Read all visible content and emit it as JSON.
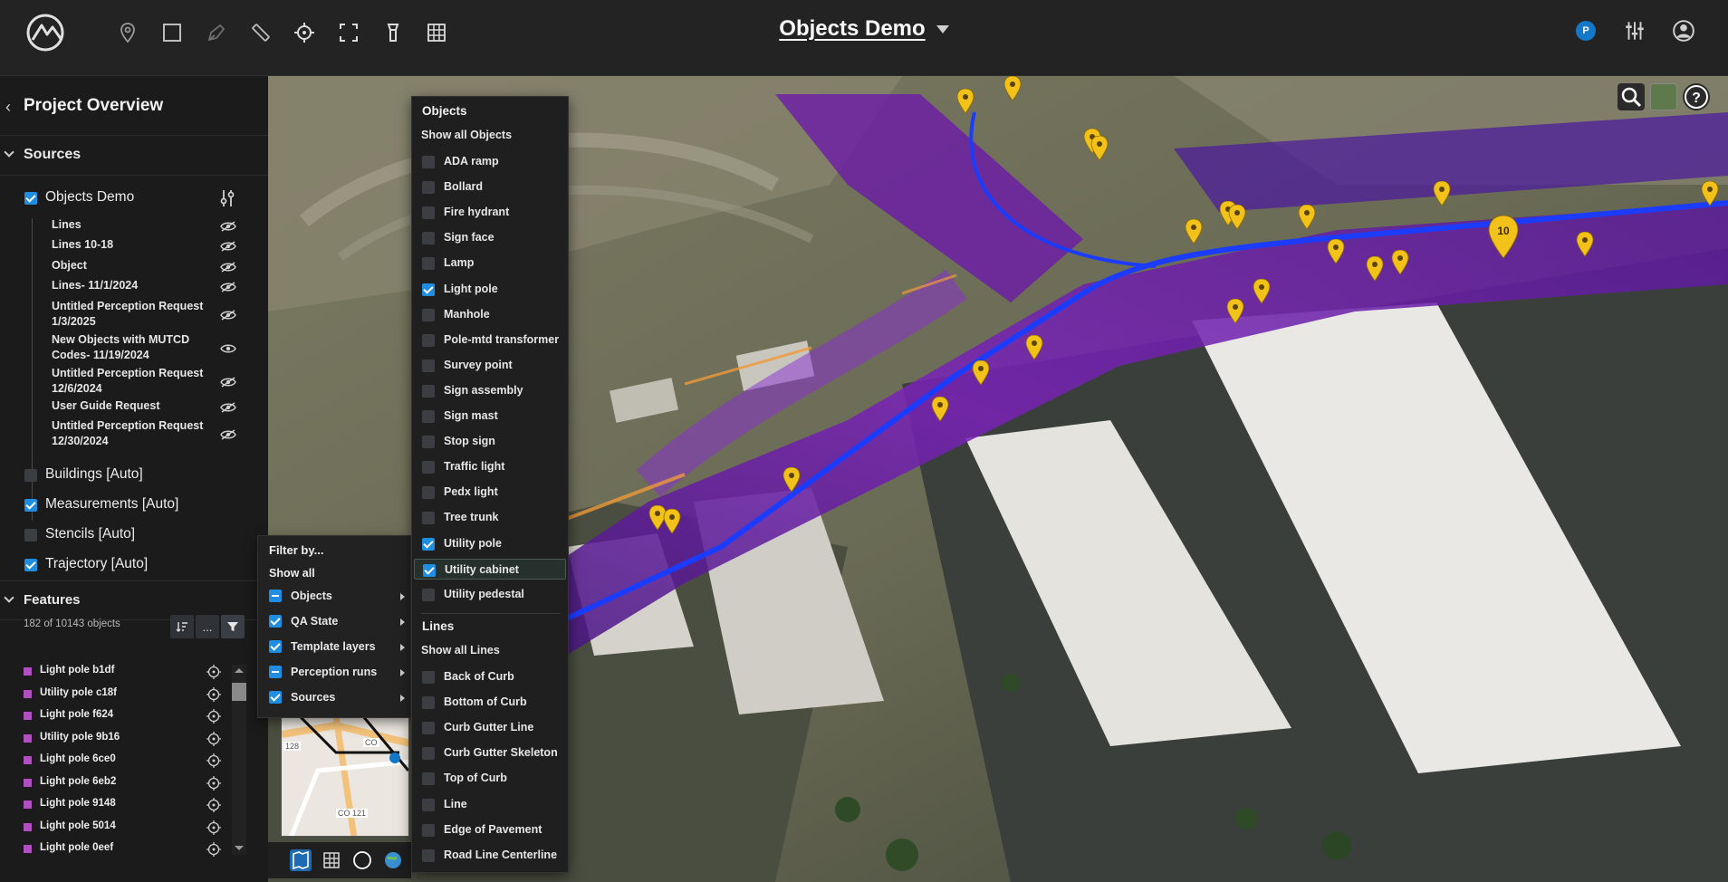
{
  "app": {
    "project_title": "Objects Demo",
    "user_initial": "P",
    "toolbar_icons": [
      "location-pin-icon",
      "rectangle-select-icon",
      "draw-polygon-icon",
      "ruler-icon",
      "crosshair-icon",
      "fullscreen-icon",
      "flashlight-icon",
      "grid-layers-icon"
    ],
    "accent_color": "#1f8de0",
    "marker_color": "#f2c21b"
  },
  "sidebar": {
    "overview_title": "Project Overview",
    "sources_heading": "Sources",
    "sources": [
      {
        "label": "Objects Demo",
        "checked": true
      },
      {
        "label": "Buildings [Auto]",
        "checked": false
      },
      {
        "label": "Measurements [Auto]",
        "checked": true
      },
      {
        "label": "Stencils [Auto]",
        "checked": false
      },
      {
        "label": "Trajectory [Auto]",
        "checked": true
      }
    ],
    "layers": [
      {
        "line1": "Lines",
        "line2": "",
        "visible": false
      },
      {
        "line1": "Lines 10-18",
        "line2": "",
        "visible": false
      },
      {
        "line1": "Object",
        "line2": "",
        "visible": false
      },
      {
        "line1": "Lines- 11/1/2024",
        "line2": "",
        "visible": false
      },
      {
        "line1": "Untitled Perception Request",
        "line2": "1/3/2025",
        "visible": false
      },
      {
        "line1": "New Objects with MUTCD",
        "line2": "Codes- 11/19/2024",
        "visible": true
      },
      {
        "line1": "Untitled Perception Request",
        "line2": "12/6/2024",
        "visible": false
      },
      {
        "line1": "User Guide Request",
        "line2": "",
        "visible": false
      },
      {
        "line1": "Untitled Perception Request",
        "line2": "12/30/2024",
        "visible": false
      }
    ],
    "features_heading": "Features",
    "features_count": "182 of 10143 objects",
    "features_more": "...",
    "features": [
      "Light pole b1df",
      "Utility pole c18f",
      "Light pole f624",
      "Utility pole 9b16",
      "Light pole 6ce0",
      "Light pole 6eb2",
      "Light pole 9148",
      "Light pole 5014",
      "Light pole 0eef"
    ]
  },
  "filter_menu": {
    "title": "Filter by...",
    "show_all": "Show all",
    "items": [
      {
        "label": "Objects",
        "state": "partial"
      },
      {
        "label": "QA State",
        "state": "checked"
      },
      {
        "label": "Template layers",
        "state": "checked"
      },
      {
        "label": "Perception runs",
        "state": "partial"
      },
      {
        "label": "Sources",
        "state": "checked"
      }
    ]
  },
  "objects_menu": {
    "objects_heading": "Objects",
    "objects_show_all": "Show all Objects",
    "objects": [
      {
        "label": "ADA ramp",
        "checked": false
      },
      {
        "label": "Bollard",
        "checked": false
      },
      {
        "label": "Fire hydrant",
        "checked": false
      },
      {
        "label": "Sign face",
        "checked": false
      },
      {
        "label": "Lamp",
        "checked": false
      },
      {
        "label": "Light pole",
        "checked": true
      },
      {
        "label": "Manhole",
        "checked": false
      },
      {
        "label": "Pole-mtd transformer",
        "checked": false
      },
      {
        "label": "Survey point",
        "checked": false
      },
      {
        "label": "Sign assembly",
        "checked": false
      },
      {
        "label": "Sign mast",
        "checked": false
      },
      {
        "label": "Stop sign",
        "checked": false
      },
      {
        "label": "Traffic light",
        "checked": false
      },
      {
        "label": "Pedx light",
        "checked": false
      },
      {
        "label": "Tree trunk",
        "checked": false
      },
      {
        "label": "Utility pole",
        "checked": true
      },
      {
        "label": "Utility cabinet",
        "checked": true
      },
      {
        "label": "Utility pedestal",
        "checked": false
      }
    ],
    "lines_heading": "Lines",
    "lines_show_all": "Show all Lines",
    "lines": [
      {
        "label": "Back of Curb",
        "checked": false
      },
      {
        "label": "Bottom of Curb",
        "checked": false
      },
      {
        "label": "Curb Gutter Line",
        "checked": false
      },
      {
        "label": "Curb Gutter Skeleton",
        "checked": false
      },
      {
        "label": "Top of Curb",
        "checked": false
      },
      {
        "label": "Line",
        "checked": false
      },
      {
        "label": "Edge of Pavement",
        "checked": false
      },
      {
        "label": "Road Line Centerline",
        "checked": false
      }
    ]
  },
  "map": {
    "cluster_label": "10",
    "minimap_labels": [
      "128",
      "CO",
      "CO 121"
    ]
  }
}
